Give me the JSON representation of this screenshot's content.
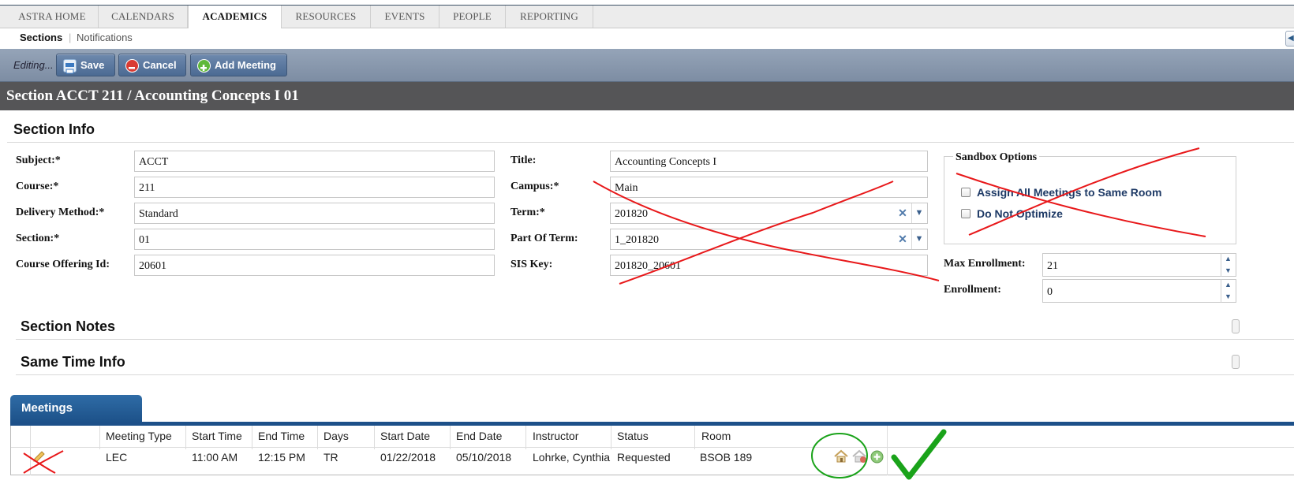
{
  "nav": {
    "tabs": [
      "ASTRA HOME",
      "CALENDARS",
      "ACADEMICS",
      "RESOURCES",
      "EVENTS",
      "PEOPLE",
      "REPORTING"
    ],
    "active_tab": "ACADEMICS",
    "subnav": {
      "active": "Sections",
      "other": "Notifications"
    }
  },
  "toolbar": {
    "editing_label": "Editing...",
    "save_label": "Save",
    "cancel_label": "Cancel",
    "add_meeting_label": "Add Meeting"
  },
  "page_title": "Section ACCT 211 / Accounting Concepts I 01",
  "section_info": {
    "heading": "Section Info",
    "subject_label": "Subject:*",
    "subject_value": "ACCT",
    "course_label": "Course:*",
    "course_value": "211",
    "delivery_label": "Delivery Method:*",
    "delivery_value": "Standard",
    "section_label": "Section:*",
    "section_value": "01",
    "offering_label": "Course Offering Id:",
    "offering_value": "20601",
    "title_label": "Title:",
    "title_value": "Accounting Concepts I",
    "campus_label": "Campus:*",
    "campus_value": "Main",
    "term_label": "Term:*",
    "term_value": "201820",
    "part_label": "Part Of Term:",
    "part_value": "1_201820",
    "sis_label": "SIS Key:",
    "sis_value": "201820_20601",
    "sandbox_legend": "Sandbox Options",
    "assign_same_room_label": "Assign All Meetings to Same Room",
    "do_not_optimize_label": "Do Not Optimize",
    "max_enroll_label": "Max Enrollment:",
    "max_enroll_value": "21",
    "enroll_label": "Enrollment:",
    "enroll_value": "0"
  },
  "section_notes": {
    "heading": "Section Notes"
  },
  "same_time": {
    "heading": "Same Time Info"
  },
  "meetings": {
    "tab_label": "Meetings",
    "columns": [
      "Meeting Type",
      "Start Time",
      "End Time",
      "Days",
      "Start Date",
      "End Date",
      "Instructor",
      "Status",
      "Room"
    ],
    "rows": [
      [
        "LEC",
        "11:00 AM",
        "12:15 PM",
        "TR",
        "01/22/2018",
        "05/10/2018",
        "Lohrke, Cynthia",
        "Requested",
        "BSOB 189"
      ]
    ]
  },
  "icons": {
    "save": "save-disk-icon",
    "cancel": "cancel-minus-icon",
    "add": "add-plus-icon",
    "row_edit": "pencil-icon",
    "room_request": "house-icon",
    "room_remove": "house-remove-icon",
    "room_add": "add-circle-icon"
  },
  "colors": {
    "nav_border": "#3d5166",
    "toolbar": "#8796ab",
    "title_band": "#555557",
    "meetings_tab": "#1d5089",
    "link_text": "#1e3a66",
    "annotation_red": "#e8181a",
    "annotation_green": "#1aa31a"
  }
}
